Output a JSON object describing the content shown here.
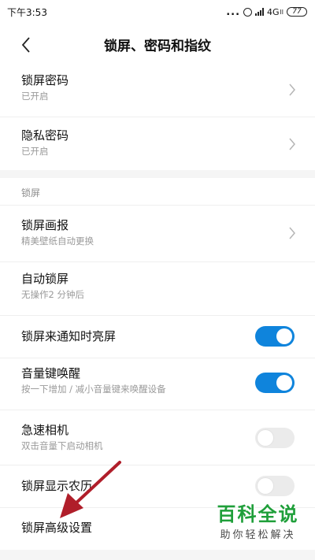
{
  "status_bar": {
    "time": "下午3:53",
    "dots": "...",
    "network": "4G",
    "network_suffix": "ll",
    "battery": "77"
  },
  "header": {
    "title": "锁屏、密码和指纹",
    "back_icon": "chevron-left-icon"
  },
  "rows": [
    {
      "title": "锁屏密码",
      "subtitle": "已开启",
      "control": "chevron"
    },
    {
      "title": "隐私密码",
      "subtitle": "已开启",
      "control": "chevron"
    }
  ],
  "section": {
    "label": "锁屏",
    "rows": [
      {
        "title": "锁屏画报",
        "subtitle": "精美壁纸自动更换",
        "control": "chevron"
      },
      {
        "title": "自动锁屏",
        "subtitle": "无操作2 分钟后",
        "control": "none"
      },
      {
        "title": "锁屏来通知时亮屏",
        "subtitle": "",
        "control": "toggle",
        "on": true
      },
      {
        "title": "音量键唤醒",
        "subtitle": "按一下增加 / 减小音量键来唤醒设备",
        "control": "toggle",
        "on": true
      },
      {
        "title": "急速相机",
        "subtitle": "双击音量下启动相机",
        "control": "toggle",
        "on": false
      },
      {
        "title": "锁屏显示农历",
        "subtitle": "",
        "control": "toggle",
        "on": false
      },
      {
        "title": "锁屏高级设置",
        "subtitle": "",
        "control": "none"
      }
    ]
  },
  "watermark": {
    "top": "百科全说",
    "bottom": "助你轻松解决"
  },
  "colors": {
    "accent": "#0f84dc",
    "toggle_off": "#ebebeb",
    "annotation_arrow": "#b01e2a",
    "watermark_green": "#1f9f3a"
  }
}
